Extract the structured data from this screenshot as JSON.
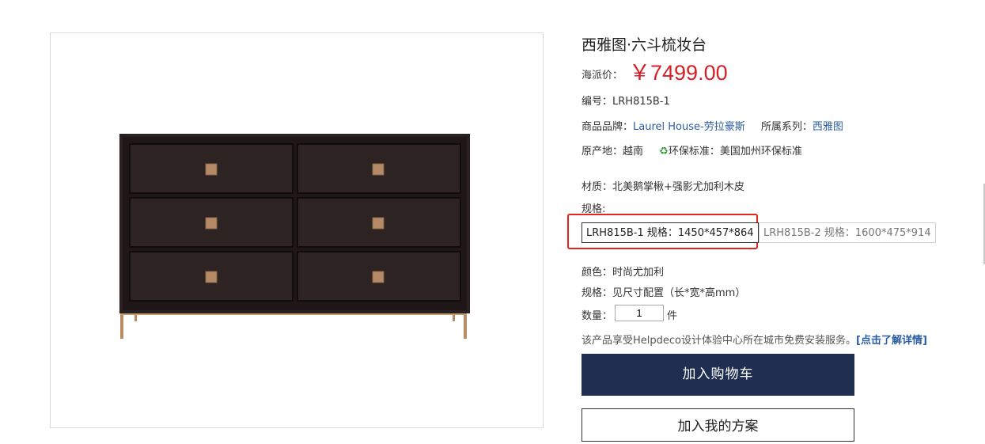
{
  "product": {
    "title": "西雅图·六斗梳妆台",
    "price_label": "海派价：",
    "price": "￥7499.00",
    "code_label": "编号：",
    "code": "LRH815B-1",
    "brand_label": "商品品牌：",
    "brand": "Laurel House-劳拉豪斯",
    "series_label": "所属系列：",
    "series": "西雅图",
    "origin_label": "原产地：",
    "origin": "越南",
    "eco_icon": "recycle-icon",
    "eco_label": "环保标准：",
    "eco": "美国加州环保标准",
    "material_label": "材质：",
    "material": "北美鹅掌楸+强影尤加利木皮",
    "spec_label": "规格:",
    "spec_options": [
      "LRH815B-1 规格：1450*457*864",
      "LRH815B-2 规格：1600*475*914"
    ],
    "color_label": "颜色：",
    "color": "时尚尤加利",
    "size_label": "规格：",
    "size": "见尺寸配置（长*宽*高mm）",
    "qty_label": "数量：",
    "qty": "1",
    "qty_unit": "件",
    "service_text": "该产品享受Helpdeco设计体验中心所在城市免费安装服务。",
    "service_link": "[点击了解详情]",
    "add_to_cart": "加入购物车",
    "add_to_favorites": "加入我的方案"
  },
  "colors": {
    "price": "#d71f27",
    "link": "#2a5d9f",
    "cart_button": "#1f2e51",
    "highlight": "#e2261d",
    "eco_icon": "#2f9b3a"
  }
}
